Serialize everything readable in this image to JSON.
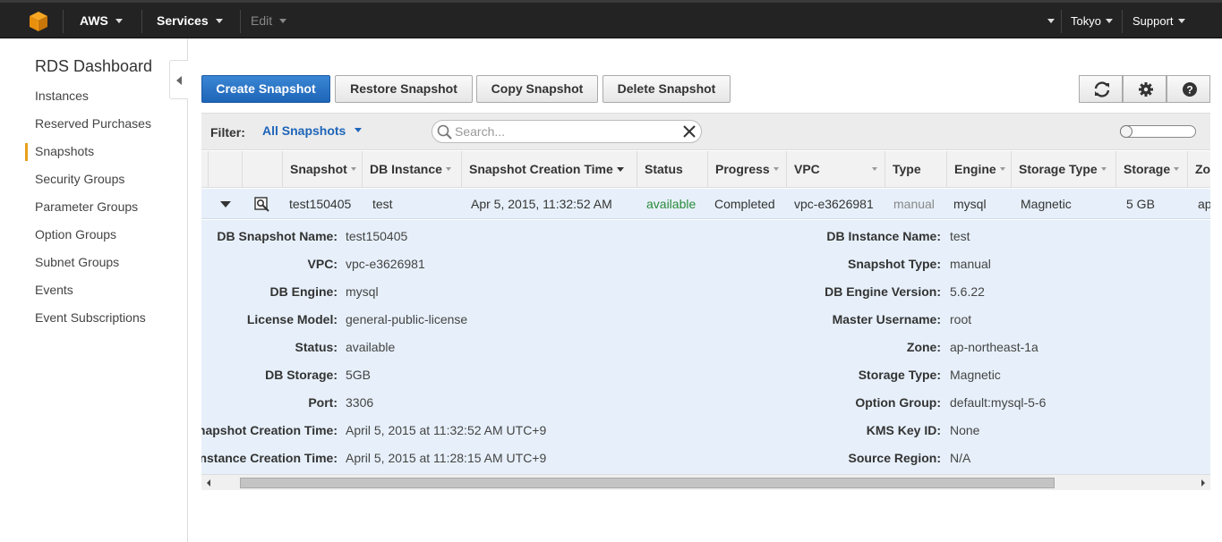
{
  "topbar": {
    "brand": "AWS",
    "services": "Services",
    "edit": "Edit",
    "region": "Tokyo",
    "support": "Support"
  },
  "sidebar": {
    "title": "RDS Dashboard",
    "items": [
      {
        "label": "Instances"
      },
      {
        "label": "Reserved Purchases"
      },
      {
        "label": "Snapshots",
        "active": true
      },
      {
        "label": "Security Groups"
      },
      {
        "label": "Parameter Groups"
      },
      {
        "label": "Option Groups"
      },
      {
        "label": "Subnet Groups"
      },
      {
        "label": "Events"
      },
      {
        "label": "Event Subscriptions"
      }
    ]
  },
  "toolbar": {
    "create": "Create Snapshot",
    "restore": "Restore Snapshot",
    "copy": "Copy Snapshot",
    "delete": "Delete Snapshot"
  },
  "filter": {
    "label": "Filter:",
    "selected": "All Snapshots",
    "search_placeholder": "Search..."
  },
  "table": {
    "columns": [
      "Snapshot",
      "DB Instance",
      "Snapshot Creation Time",
      "Status",
      "Progress",
      "VPC",
      "Type",
      "Engine",
      "Storage Type",
      "Storage",
      "Zo"
    ],
    "row": {
      "snapshot": "test150405",
      "db_instance": "test",
      "creation_time": "Apr 5, 2015, 11:32:52 AM",
      "status": "available",
      "progress": "Completed",
      "vpc": "vpc-e3626981",
      "type": "manual",
      "engine": "mysql",
      "storage_type": "Magnetic",
      "storage": "5 GB",
      "zone": "ap"
    }
  },
  "details": {
    "left": [
      {
        "label": "DB Snapshot Name:",
        "value": "test150405"
      },
      {
        "label": "VPC:",
        "value": "vpc-e3626981"
      },
      {
        "label": "DB Engine:",
        "value": "mysql"
      },
      {
        "label": "License Model:",
        "value": "general-public-license"
      },
      {
        "label": "Status:",
        "value": "available"
      },
      {
        "label": "DB Storage:",
        "value": "5GB"
      },
      {
        "label": "Port:",
        "value": "3306"
      },
      {
        "label": "Snapshot Creation Time:",
        "value": "April 5, 2015 at 11:32:52 AM UTC+9"
      },
      {
        "label": "DB Instance Creation Time:",
        "value": "April 5, 2015 at 11:28:15 AM UTC+9"
      }
    ],
    "right": [
      {
        "label": "DB Instance Name:",
        "value": "test"
      },
      {
        "label": "Snapshot Type:",
        "value": "manual"
      },
      {
        "label": "DB Engine Version:",
        "value": "5.6.22"
      },
      {
        "label": "Master Username:",
        "value": "root"
      },
      {
        "label": "Zone:",
        "value": "ap-northeast-1a"
      },
      {
        "label": "Storage Type:",
        "value": "Magnetic"
      },
      {
        "label": "Option Group:",
        "value": "default:mysql-5-6"
      },
      {
        "label": "KMS Key ID:",
        "value": "None"
      },
      {
        "label": "Source Region:",
        "value": "N/A"
      }
    ]
  }
}
